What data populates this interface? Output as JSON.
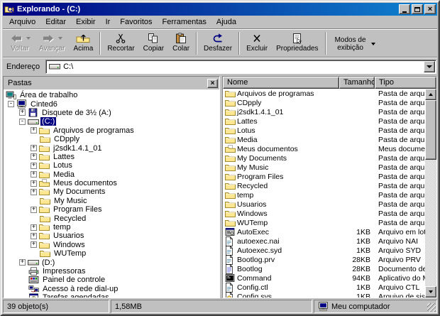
{
  "window": {
    "title": "Explorando -  (C:)"
  },
  "menu": {
    "items": [
      {
        "id": "arquivo",
        "label": "Arquivo"
      },
      {
        "id": "editar",
        "label": "Editar"
      },
      {
        "id": "exibir",
        "label": "Exibir"
      },
      {
        "id": "ir",
        "label": "Ir"
      },
      {
        "id": "favoritos",
        "label": "Favoritos"
      },
      {
        "id": "ferramentas",
        "label": "Ferramentas"
      },
      {
        "id": "ajuda",
        "label": "Ajuda"
      }
    ]
  },
  "toolbar": {
    "buttons": [
      {
        "id": "voltar",
        "label": "Voltar",
        "icon": "back",
        "disabled": true,
        "dropdown": true,
        "sep_after": false,
        "two_line": false
      },
      {
        "id": "avancar",
        "label": "Avançar",
        "icon": "forward",
        "disabled": true,
        "dropdown": true,
        "sep_after": false,
        "two_line": false
      },
      {
        "id": "acima",
        "label": "Acima",
        "icon": "up",
        "disabled": false,
        "dropdown": false,
        "sep_after": true,
        "two_line": false
      },
      {
        "id": "recortar",
        "label": "Recortar",
        "icon": "cut",
        "disabled": false,
        "dropdown": false,
        "sep_after": false,
        "two_line": false
      },
      {
        "id": "copiar",
        "label": "Copiar",
        "icon": "copy",
        "disabled": false,
        "dropdown": false,
        "sep_after": false,
        "two_line": false
      },
      {
        "id": "colar",
        "label": "Colar",
        "icon": "paste",
        "disabled": false,
        "dropdown": false,
        "sep_after": true,
        "two_line": false
      },
      {
        "id": "desfazer",
        "label": "Desfazer",
        "icon": "undo",
        "disabled": false,
        "dropdown": false,
        "sep_after": true,
        "two_line": false
      },
      {
        "id": "excluir",
        "label": "Excluir",
        "icon": "delete",
        "disabled": false,
        "dropdown": false,
        "sep_after": false,
        "two_line": false
      },
      {
        "id": "propriedades",
        "label": "Propriedades",
        "icon": "properties",
        "disabled": false,
        "dropdown": false,
        "sep_after": true,
        "two_line": false
      },
      {
        "id": "modos",
        "label": "Modos de exibição",
        "icon": null,
        "disabled": false,
        "dropdown": true,
        "sep_after": false,
        "two_line": true
      }
    ]
  },
  "address": {
    "label": "Endereço",
    "value": "C:\\"
  },
  "folders_panel": {
    "title": "Pastas"
  },
  "tree": {
    "items": [
      {
        "label": "Área de trabalho",
        "level": 0,
        "expander": null,
        "icon": "desktop",
        "selected": false
      },
      {
        "label": "Cinted6",
        "level": 1,
        "expander": "minus",
        "icon": "computer",
        "selected": false
      },
      {
        "label": "Disquete de 3½ (A:)",
        "level": 2,
        "expander": "plus",
        "icon": "floppy",
        "selected": false
      },
      {
        "label": "(C:)",
        "level": 2,
        "expander": "minus",
        "icon": "drive",
        "selected": true
      },
      {
        "label": "Arquivos de programas",
        "level": 3,
        "expander": "plus",
        "icon": "folder",
        "selected": false
      },
      {
        "label": "CDpply",
        "level": 3,
        "expander": null,
        "icon": "folder",
        "selected": false
      },
      {
        "label": "j2sdk1.4.1_01",
        "level": 3,
        "expander": "plus",
        "icon": "folder",
        "selected": false
      },
      {
        "label": "Lattes",
        "level": 3,
        "expander": "plus",
        "icon": "folder",
        "selected": false
      },
      {
        "label": "Lotus",
        "level": 3,
        "expander": "plus",
        "icon": "folder",
        "selected": false
      },
      {
        "label": "Media",
        "level": 3,
        "expander": "plus",
        "icon": "folder",
        "selected": false
      },
      {
        "label": "Meus documentos",
        "level": 3,
        "expander": "plus",
        "icon": "mydocs",
        "selected": false
      },
      {
        "label": "My Documents",
        "level": 3,
        "expander": "plus",
        "icon": "folder",
        "selected": false
      },
      {
        "label": "My Music",
        "level": 3,
        "expander": null,
        "icon": "folder",
        "selected": false
      },
      {
        "label": "Program Files",
        "level": 3,
        "expander": "plus",
        "icon": "folder",
        "selected": false
      },
      {
        "label": "Recycled",
        "level": 3,
        "expander": null,
        "icon": "folder",
        "selected": false
      },
      {
        "label": "temp",
        "level": 3,
        "expander": "plus",
        "icon": "folder",
        "selected": false
      },
      {
        "label": "Usuarios",
        "level": 3,
        "expander": "plus",
        "icon": "folder",
        "selected": false
      },
      {
        "label": "Windows",
        "level": 3,
        "expander": "plus",
        "icon": "folder",
        "selected": false
      },
      {
        "label": "WUTemp",
        "level": 3,
        "expander": null,
        "icon": "folder",
        "selected": false
      },
      {
        "label": "(D:)",
        "level": 2,
        "expander": "plus",
        "icon": "drive",
        "selected": false
      },
      {
        "label": "Impressoras",
        "level": 2,
        "expander": null,
        "icon": "printer",
        "selected": false
      },
      {
        "label": "Painel de controle",
        "level": 2,
        "expander": null,
        "icon": "controlpanel",
        "selected": false
      },
      {
        "label": "Acesso à rede dial-up",
        "level": 2,
        "expander": null,
        "icon": "dialup",
        "selected": false
      },
      {
        "label": "Tarefas agendadas",
        "level": 2,
        "expander": null,
        "icon": "tasks",
        "selected": false
      }
    ]
  },
  "files": {
    "columns": [
      {
        "id": "name",
        "label": "Nome"
      },
      {
        "id": "size",
        "label": "Tamanho"
      },
      {
        "id": "type",
        "label": "Tipo"
      }
    ],
    "rows": [
      {
        "name": "Arquivos de programas",
        "size": "",
        "type": "Pasta de arquivos",
        "icon": "folder"
      },
      {
        "name": "CDpply",
        "size": "",
        "type": "Pasta de arquivos",
        "icon": "folder"
      },
      {
        "name": "j2sdk1.4.1_01",
        "size": "",
        "type": "Pasta de arquivos",
        "icon": "folder"
      },
      {
        "name": "Lattes",
        "size": "",
        "type": "Pasta de arquivos",
        "icon": "folder"
      },
      {
        "name": "Lotus",
        "size": "",
        "type": "Pasta de arquivos",
        "icon": "folder"
      },
      {
        "name": "Media",
        "size": "",
        "type": "Pasta de arquivos",
        "icon": "folder"
      },
      {
        "name": "Meus documentos",
        "size": "",
        "type": "Meus documentos",
        "icon": "mydocs"
      },
      {
        "name": "My Documents",
        "size": "",
        "type": "Pasta de arquivos",
        "icon": "folder"
      },
      {
        "name": "My Music",
        "size": "",
        "type": "Pasta de arquivos",
        "icon": "folder"
      },
      {
        "name": "Program Files",
        "size": "",
        "type": "Pasta de arquivos",
        "icon": "folder"
      },
      {
        "name": "Recycled",
        "size": "",
        "type": "Pasta de arquivos",
        "icon": "folder"
      },
      {
        "name": "temp",
        "size": "",
        "type": "Pasta de arquivos",
        "icon": "folder"
      },
      {
        "name": "Usuarios",
        "size": "",
        "type": "Pasta de arquivos",
        "icon": "folder"
      },
      {
        "name": "Windows",
        "size": "",
        "type": "Pasta de arquivos",
        "icon": "folder"
      },
      {
        "name": "WUTemp",
        "size": "",
        "type": "Pasta de arquivos",
        "icon": "folder"
      },
      {
        "name": "AutoExec",
        "size": "1KB",
        "type": "Arquivo em lotes MS",
        "icon": "batch"
      },
      {
        "name": "autoexec.nai",
        "size": "1KB",
        "type": "Arquivo NAI",
        "icon": "file"
      },
      {
        "name": "Autoexec.syd",
        "size": "1KB",
        "type": "Arquivo SYD",
        "icon": "file"
      },
      {
        "name": "Bootlog.prv",
        "size": "28KB",
        "type": "Arquivo PRV",
        "icon": "file"
      },
      {
        "name": "Bootlog",
        "size": "28KB",
        "type": "Documento de texto",
        "icon": "textfile"
      },
      {
        "name": "Command",
        "size": "94KB",
        "type": "Aplicativo do MS-D",
        "icon": "msdos"
      },
      {
        "name": "Config.ctl",
        "size": "1KB",
        "type": "Arquivo CTL",
        "icon": "file"
      },
      {
        "name": "Config.sys",
        "size": "1KB",
        "type": "Arquivo de sistema",
        "icon": "sysfile"
      }
    ]
  },
  "statusbar": {
    "objects": "39 objeto(s)",
    "free_space": "1,58MB",
    "location": "Meu computador"
  },
  "colors": {
    "titlebar_start": "#000080",
    "titlebar_end": "#1084d0",
    "selection": "#000080",
    "chrome": "#c0c0c0",
    "highlight_text": "#ffffff",
    "folder_fill": "#ffe792"
  }
}
